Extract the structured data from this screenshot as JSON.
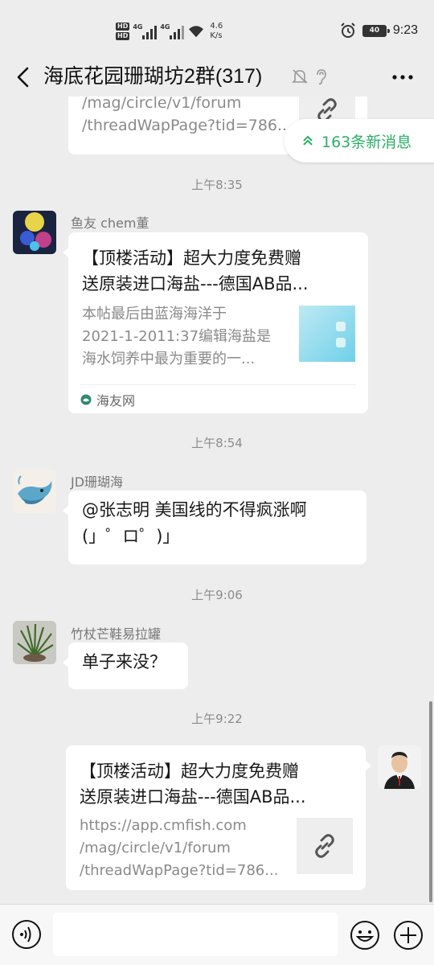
{
  "status_bar": {
    "hd1": "HD",
    "hd2": "HD",
    "net1": "4G",
    "net2": "4G",
    "speed_value": "4.6",
    "speed_unit": "K/s",
    "battery": "40",
    "time": "9:23"
  },
  "header": {
    "title": "海底花园珊瑚坊2群(317)"
  },
  "new_messages": {
    "label": "163条新消息"
  },
  "messages": [
    {
      "type": "link-partial",
      "desc_line1": "/mag/circle/v1/forum",
      "desc_line2": "/threadWapPage?tid=786..."
    },
    {
      "type": "time",
      "text": "上午8:35"
    },
    {
      "type": "link",
      "sender": "鱼友 chem董",
      "title_line1": "【顶楼活动】超大力度免费赠",
      "title_line2": "送原装进口海盐---德国AB品...",
      "desc_line1": "本帖最后由蓝海海洋于",
      "desc_line2": "2021-1-2011:37编辑海盐是",
      "desc_line3": "海水饲养中最为重要的一...",
      "source": "海友网"
    },
    {
      "type": "time",
      "text": "上午8:54"
    },
    {
      "type": "text",
      "sender": "JD珊瑚海",
      "line1": "@张志明 美国线的不得疯涨啊",
      "line2": "(」゜ロ゜)」"
    },
    {
      "type": "time",
      "text": "上午9:06"
    },
    {
      "type": "text",
      "sender": "竹杖芒鞋易拉罐",
      "line1": "单子来没？"
    },
    {
      "type": "time",
      "text": "上午9:22"
    },
    {
      "type": "link-self",
      "title_line1": "【顶楼活动】超大力度免费赠",
      "title_line2": "送原装进口海盐---德国AB品...",
      "desc_line1": "https://app.cmfish.com",
      "desc_line2": "/mag/circle/v1/forum",
      "desc_line3": "/threadWapPage?tid=786..."
    }
  ],
  "input": {
    "value": ""
  },
  "colors": {
    "accent": "#2aae67",
    "background": "#ededed",
    "bubble": "#ffffff"
  }
}
